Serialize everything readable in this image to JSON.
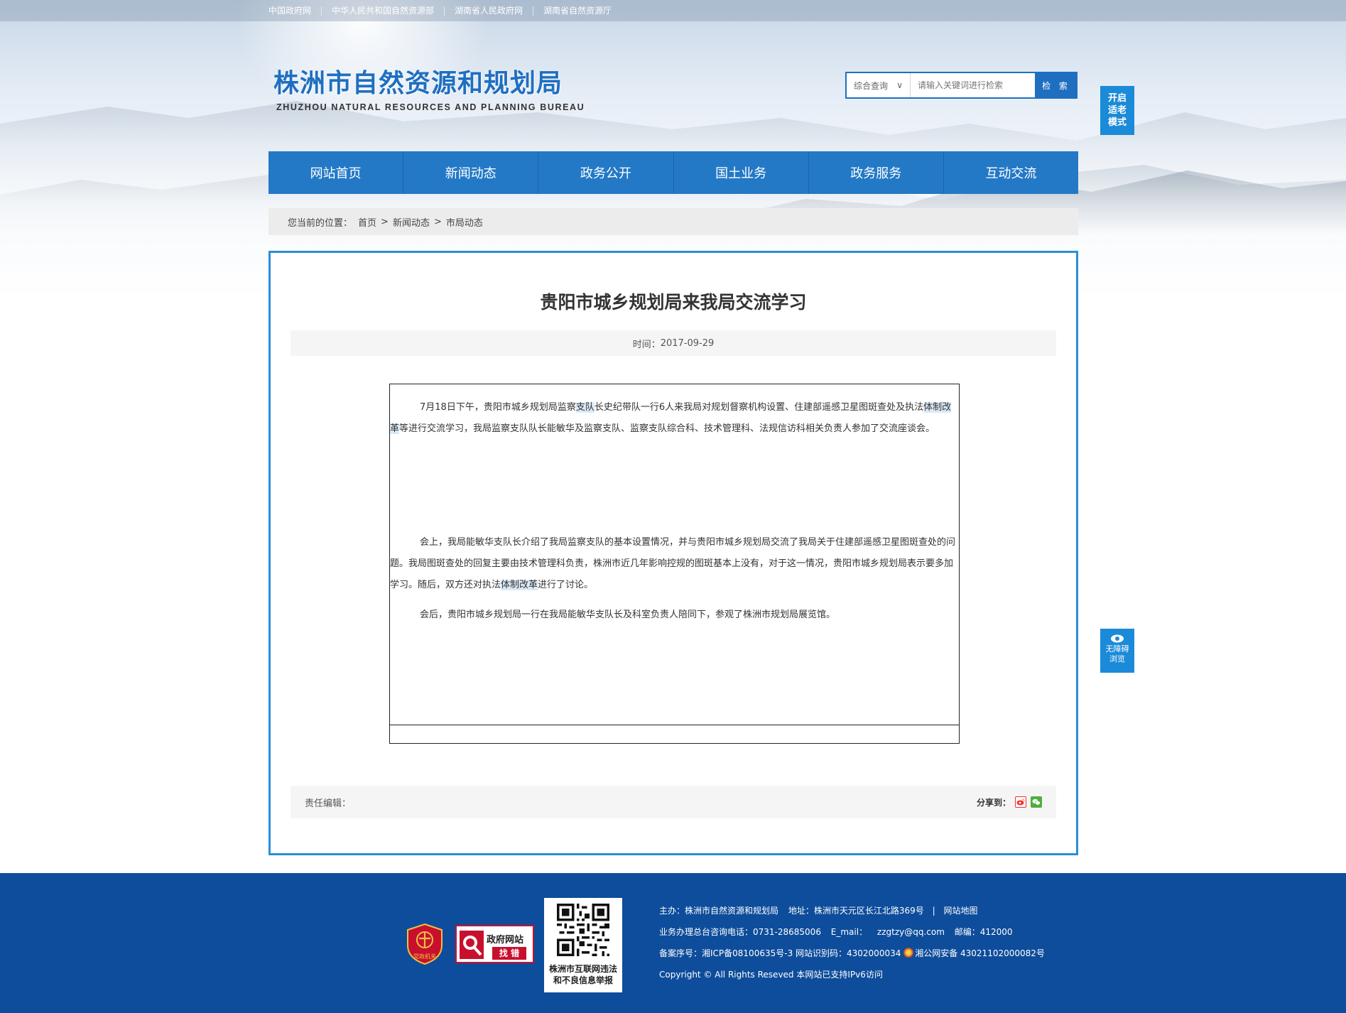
{
  "topbar": {
    "links": [
      "中国政府网",
      "中华人民共和国自然资源部",
      "湖南省人民政府网",
      "湖南省自然资源厅"
    ]
  },
  "header": {
    "logo_cn": "株洲市自然资源和规划局",
    "logo_en": "ZHUZHOU NATURAL RESOURCES AND PLANNING BUREAU"
  },
  "search": {
    "category": "综合查询",
    "category_arrow": "∨",
    "placeholder": "请输入关键词进行检索",
    "button": "检 索"
  },
  "float": {
    "elder_mode": [
      "开启",
      "适老",
      "模式"
    ],
    "accessible": [
      "无障碍",
      "浏览"
    ]
  },
  "nav": {
    "items": [
      "网站首页",
      "新闻动态",
      "政务公开",
      "国土业务",
      "政务服务",
      "互动交流"
    ]
  },
  "breadcrumb": {
    "prefix": "您当前的位置：",
    "home": "首页",
    "sep": ">",
    "level1": "新闻动态",
    "level2": "市局动态"
  },
  "article": {
    "title": "贵阳市城乡规划局来我局交流学习",
    "date_label": "时间：",
    "date": "2017-09-29",
    "p1_a": "7月18日下午，贵阳市城乡规划局监察",
    "p1_hl1": "支队",
    "p1_b": "长史纪带队一行6人来我局对规划督察机构设置、住建部遥感卫星图斑查处及执法",
    "p1_hl2": "体制改革",
    "p1_c": "等进行交流学习，我局监察支队队长能敏华及监察支队、监察支队综合科、技术管理科、法规信访科相关负责人参加了交流座谈会。",
    "p2_a": "会上，我局能敏华支队长介绍了我局监察支队的基本设置情况，并与贵阳市城乡规划局交流了我局关于住建部遥感卫星图斑查处的问题。我局图斑查处的回复主要由技术管理科负责，株洲市近几年影响控规的图斑基本上没有，对于这一情况，贵阳市城乡规划局表示要多加学习。随后，双方还对执法",
    "p2_hl": "体制改革",
    "p2_b": "进行了讨论。",
    "p3": "会后，贵阳市城乡规划局一行在我局能敏华支队长及科室负责人陪同下，参观了株洲市规划局展览馆。",
    "editor_label": "责任编辑：",
    "share_label": "分享到："
  },
  "footer": {
    "party_badge": "党政机关",
    "govsite_title": "政府网站",
    "govsite_sub": "找 错",
    "qr_caption": [
      "株洲市互联网违法",
      "和不良信息举报"
    ],
    "line1_host": "主办：株洲市自然资源和规划局",
    "line1_addr": "地址：株洲市天元区长江北路369号",
    "line1_sep": "|",
    "line1_map": "网站地图",
    "line2_phone": "业务办理总台咨询电话：0731-28685006",
    "line2_email_label": "E_mail：",
    "line2_email": "zzgtzy@qq.com",
    "line2_zip": "邮编：412000",
    "line3_icp": "备案序号：湘ICP备08100635号-3 网站识别码：4302000034",
    "line3_police": "湘公网安备 43021102000082号",
    "line4": "Copyright © All Rights Reseved 本网站已支持IPv6访问"
  },
  "colors": {
    "primary": "#2379c6",
    "article_border": "#2a8fd6",
    "footer_bg": "#0e4d9b",
    "float_btn": "#1b8ad9"
  }
}
